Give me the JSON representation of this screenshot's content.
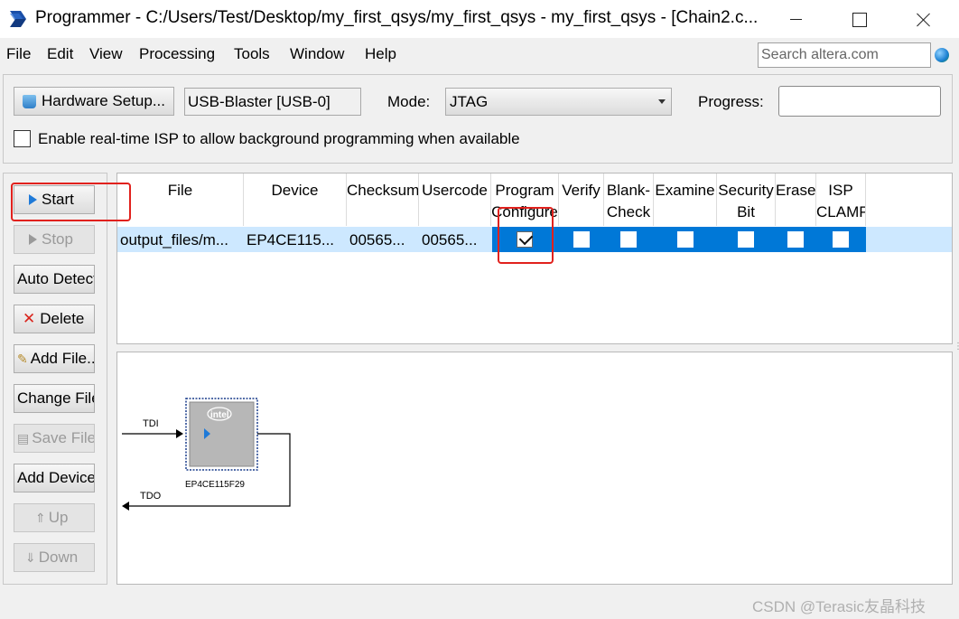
{
  "window": {
    "title": "Programmer - C:/Users/Test/Desktop/my_first_qsys/my_first_qsys - my_first_qsys - [Chain2.c..."
  },
  "menu": {
    "items": [
      "File",
      "Edit",
      "View",
      "Processing",
      "Tools",
      "Window",
      "Help"
    ],
    "search_placeholder": "Search altera.com"
  },
  "toolbar": {
    "hardware_setup_label": "Hardware Setup...",
    "hardware_value": "USB-Blaster [USB-0]",
    "mode_label": "Mode:",
    "mode_value": "JTAG",
    "progress_label": "Progress:",
    "progress_value": "",
    "isp_label": "Enable real-time ISP to allow background programming when available",
    "isp_checked": false
  },
  "side_buttons": {
    "start": "Start",
    "stop": "Stop",
    "auto_detect": "Auto Detect",
    "delete": "Delete",
    "add_file": "Add File...",
    "change_file": "Change File...",
    "save_file": "Save File",
    "add_device": "Add Device...",
    "up": "Up",
    "down": "Down"
  },
  "table": {
    "headers": {
      "file": "File",
      "device": "Device",
      "checksum": "Checksum",
      "usercode": "Usercode",
      "program": [
        "Program",
        "Configure"
      ],
      "verify": "Verify",
      "blank_check": [
        "Blank-",
        "Check"
      ],
      "examine": "Examine",
      "security_bit": [
        "Security",
        "Bit"
      ],
      "erase": "Erase",
      "isp_clamp": [
        "ISP",
        "CLAMP"
      ]
    },
    "rows": [
      {
        "file": "output_files/m...",
        "device": "EP4CE115...",
        "checksum": "00565...",
        "usercode": "00565...",
        "program": true,
        "verify": false,
        "blank_check": false,
        "examine": false,
        "security_bit": false,
        "erase": false,
        "isp_clamp": false
      }
    ]
  },
  "chain": {
    "tdi_label": "TDI",
    "tdo_label": "TDO",
    "chip_brand": "intel",
    "device_label": "EP4CE115F29"
  },
  "watermark": "CSDN @Terasic友晶科技",
  "colors": {
    "selection": "#0078d7",
    "row_highlight": "#cde8ff",
    "annotation_red": "#e1211d"
  }
}
